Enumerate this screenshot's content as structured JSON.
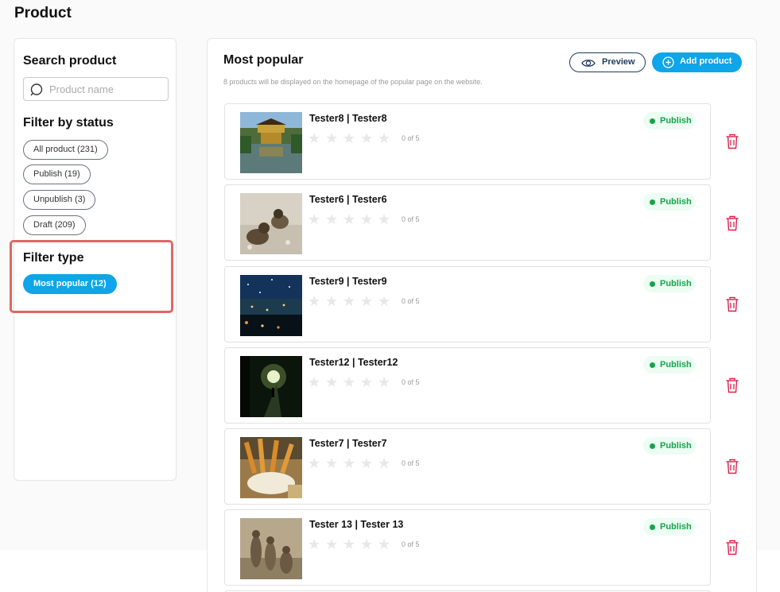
{
  "page": {
    "title": "Product"
  },
  "sidebar": {
    "search_title": "Search product",
    "search_placeholder": "Product name",
    "status_title": "Filter by status",
    "status_filters": [
      {
        "label": "All product (231)"
      },
      {
        "label": "Publish (19)"
      },
      {
        "label": "Unpublish (3)"
      },
      {
        "label": "Draft (209)"
      }
    ],
    "type_title": "Filter type",
    "type_filters": [
      {
        "label": "Most popular (12)",
        "active": true
      }
    ]
  },
  "main": {
    "title": "Most popular",
    "subtitle": "8 products will be displayed on the homepage of the popular page on the website.",
    "preview_label": "Preview",
    "add_label": "Add product",
    "products": [
      {
        "name": "Tester8 | Tester8",
        "rating": "0 of 5",
        "status": "Publish",
        "image": "golden-pavilion"
      },
      {
        "name": "Tester6 | Tester6",
        "rating": "0 of 5",
        "status": "Publish",
        "image": "ducklings"
      },
      {
        "name": "Tester9 | Tester9",
        "rating": "0 of 5",
        "status": "Publish",
        "image": "night-city"
      },
      {
        "name": "Tester12 | Tester12",
        "rating": "0 of 5",
        "status": "Publish",
        "image": "night-street"
      },
      {
        "name": "Tester7 | Tester7",
        "rating": "0 of 5",
        "status": "Publish",
        "image": "churros"
      },
      {
        "name": "Tester 13 | Tester 13",
        "rating": "0 of 5",
        "status": "Publish",
        "image": "meerkats"
      }
    ]
  },
  "colors": {
    "accent": "#0ea5e9",
    "publish": "#16a34a",
    "highlight": "#e06666",
    "delete": "#e11d48"
  }
}
